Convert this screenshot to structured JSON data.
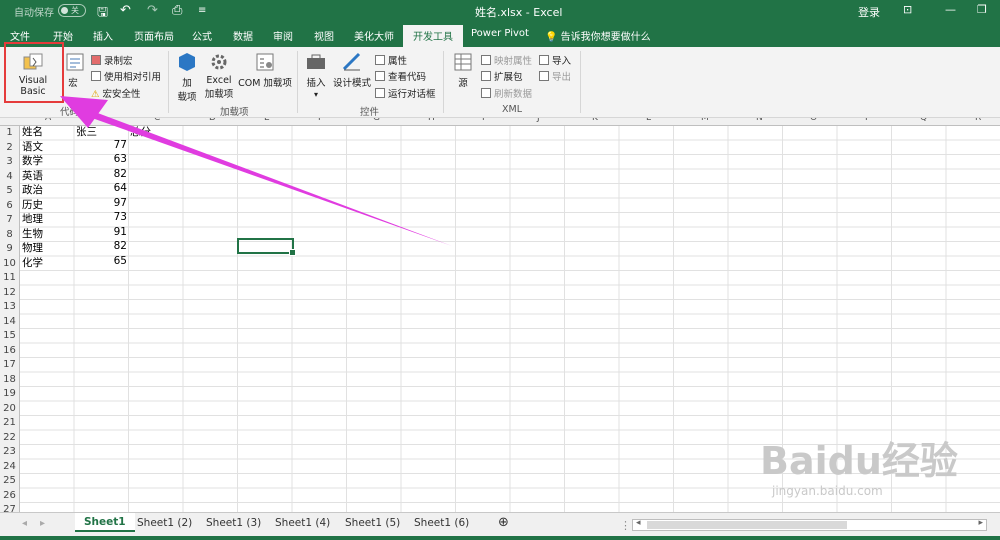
{
  "titlebar": {
    "autosave": "自动保存",
    "toggle": "关",
    "doc_title": "姓名.xlsx - Excel",
    "login": "登录",
    "qat_save": "🖫",
    "qat_undo": "↶",
    "qat_redo": "↷",
    "qat_preview": "⎙",
    "qat_more": "≡"
  },
  "tabs": [
    "文件",
    "开始",
    "插入",
    "页面布局",
    "公式",
    "数据",
    "审阅",
    "视图",
    "美化大师",
    "开发工具",
    "Power Pivot",
    "告诉我你想要做什么"
  ],
  "ribbon": {
    "visual_basic": "Visual Basic",
    "macro": "宏",
    "record_macro": "录制宏",
    "relative_ref": "使用相对引用",
    "macro_security": "宏安全性",
    "code_group": "代码",
    "addins": "加\n载项",
    "addins_a": "加",
    "addins_b": "载项",
    "excel_addins_a": "Excel",
    "excel_addins_b": "加载项",
    "com_addins": "COM 加载项",
    "addins_group": "加载项",
    "insert": "插入",
    "design_mode": "设计模式",
    "properties": "属性",
    "view_code": "查看代码",
    "run_dialog": "运行对话框",
    "controls_group": "控件",
    "source": "源",
    "map_props": "映射属性",
    "expansion": "扩展包",
    "refresh": "刷新数据",
    "import": "导入",
    "export": "导出",
    "xml_group": "XML"
  },
  "columns": [
    "A",
    "B",
    "C",
    "D",
    "E",
    "F",
    "G",
    "H",
    "I",
    "J",
    "K",
    "L",
    "M",
    "N",
    "O",
    "P",
    "Q",
    "R"
  ],
  "rows": [
    "1",
    "2",
    "3",
    "4",
    "5",
    "6",
    "7",
    "8",
    "9",
    "10",
    "11",
    "12",
    "13",
    "14",
    "15",
    "16",
    "17",
    "18",
    "19",
    "20",
    "21",
    "22",
    "23",
    "24",
    "25",
    "26",
    "27"
  ],
  "table": {
    "header": [
      "姓名",
      "张三",
      "总分"
    ],
    "subjects": [
      "语文",
      "数学",
      "英语",
      "政治",
      "历史",
      "地理",
      "生物",
      "物理",
      "化学"
    ],
    "scores": [
      "77",
      "63",
      "82",
      "64",
      "97",
      "73",
      "91",
      "82",
      "65"
    ]
  },
  "sheets": [
    "Sheet1",
    "Sheet1 (2)",
    "Sheet1 (3)",
    "Sheet1 (4)",
    "Sheet1 (5)",
    "Sheet1 (6)"
  ],
  "add_sheet": "⊕",
  "watermark": "Baidu经验",
  "watermark_url": "jingyan.baidu.com",
  "colors": {
    "excel_green": "#217346",
    "arrow": "#e03ce0",
    "highlight": "#e53b3b"
  }
}
